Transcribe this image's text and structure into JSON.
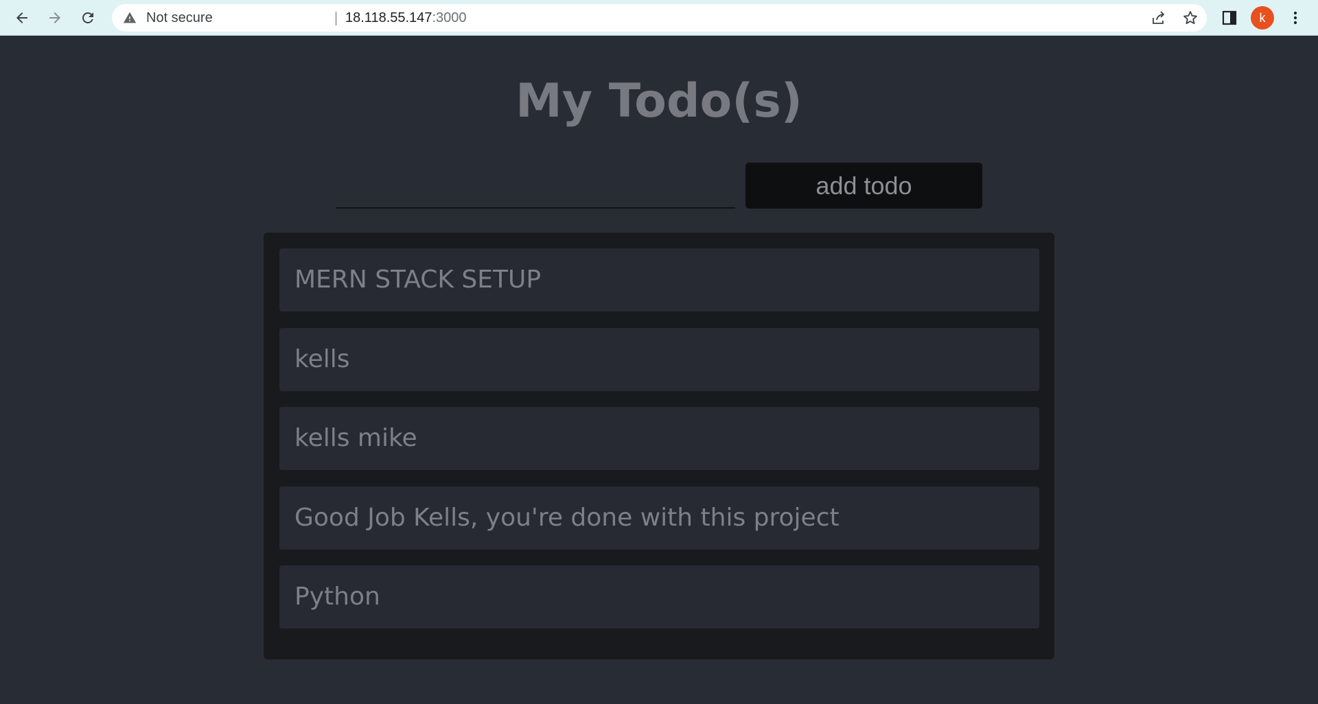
{
  "browser": {
    "security_label": "Not secure",
    "url_host": "18.118.55.147",
    "url_port": ":3000",
    "profile_initial": "k",
    "accent_color": "#e8501f"
  },
  "app": {
    "title": "My Todo(s)",
    "input": {
      "value": "",
      "placeholder": ""
    },
    "add_button_label": "add todo",
    "todos": [
      {
        "text": "MERN STACK SETUP"
      },
      {
        "text": "kells"
      },
      {
        "text": "kells mike"
      },
      {
        "text": "Good Job Kells, you're done with this project"
      },
      {
        "text": "Python"
      }
    ],
    "colors": {
      "background": "#282c34",
      "panel": "#181a1e",
      "item": "#272a33",
      "text": "#7d8087"
    }
  }
}
